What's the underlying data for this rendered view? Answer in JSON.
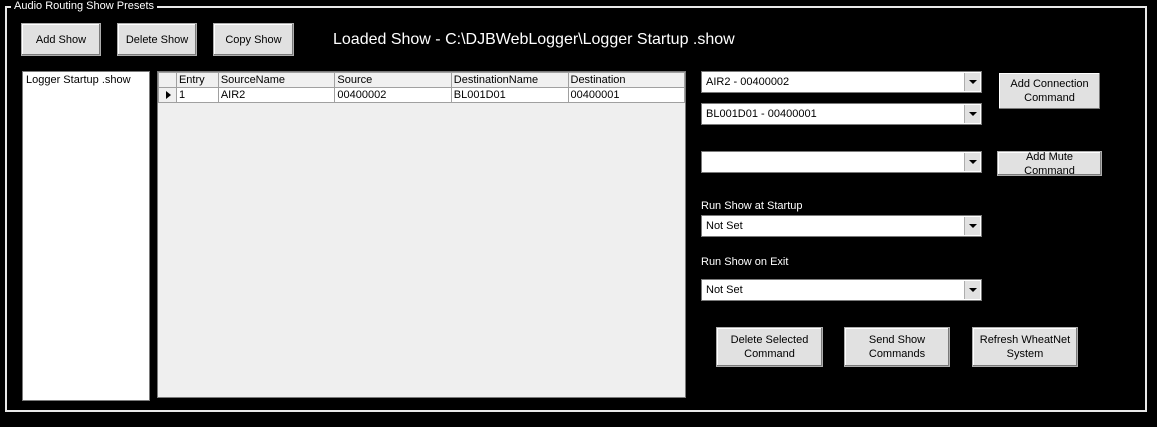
{
  "group": {
    "title": "Audio Routing Show Presets"
  },
  "toolbar": {
    "add_show": "Add Show",
    "delete_show": "Delete Show",
    "copy_show": "Copy Show"
  },
  "loaded_show_title": "Loaded Show - C:\\DJBWebLogger\\Logger Startup .show",
  "show_list": [
    "Logger Startup .show"
  ],
  "grid": {
    "columns": [
      "Entry",
      "SourceName",
      "Source",
      "DestinationName",
      "Destination"
    ],
    "rows": [
      [
        "1",
        "AIR2",
        "00400002",
        "BL001D01",
        "00400001"
      ]
    ]
  },
  "connection": {
    "source_select": "AIR2 - 00400002",
    "dest_select": "BL001D01 - 00400001",
    "add_connection_label": "Add Connection Command",
    "mute_select": "",
    "add_mute_label": "Add Mute Command"
  },
  "startup": {
    "label": "Run Show at Startup",
    "value": "Not Set"
  },
  "exit": {
    "label": "Run Show on Exit",
    "value": "Not Set"
  },
  "actions": {
    "delete_selected": "Delete Selected Command",
    "send_show": "Send Show Commands",
    "refresh": "Refresh WheatNet System"
  }
}
